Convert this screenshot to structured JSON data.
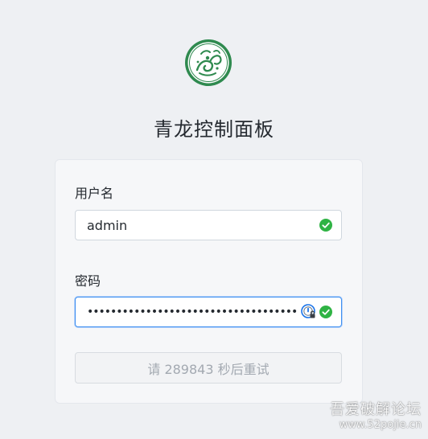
{
  "app": {
    "title": "青龙控制面板"
  },
  "login": {
    "username_label": "用户名",
    "username_value": "admin",
    "password_label": "密码",
    "password_value": "••••••••••••••••••••••••••••••••••••",
    "submit_label": "请 289843 秒后重试"
  },
  "watermark": {
    "text": "吾爱破解论坛",
    "url": "www.52pojie.cn"
  },
  "icons": {
    "logo": "qinglong-dragon-logo",
    "field_valid": "check-circle-icon",
    "password_manager": "password-manager-icon"
  },
  "colors": {
    "logo_green": "#2f8a4f",
    "valid_green": "#2fb344",
    "focus_blue": "#3d8ef0"
  }
}
